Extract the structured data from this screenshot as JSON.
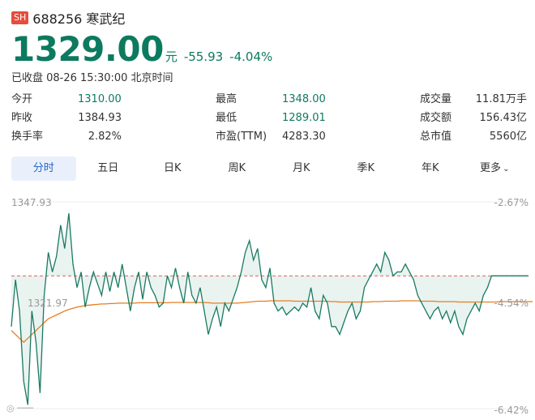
{
  "stock": {
    "market": "SH",
    "code_name": "688256 寒武纪"
  },
  "quote": {
    "price": "1329.00",
    "unit": "元",
    "change": "-55.93",
    "change_pct": "-4.04%"
  },
  "status_text": "已收盘 08-26 15:30:00 北京时间",
  "stats": {
    "open_label": "今开",
    "open": "1310.00",
    "high_label": "最高",
    "high": "1348.00",
    "volume_label": "成交量",
    "volume": "11.81万手",
    "prevclose_label": "昨收",
    "prevclose": "1384.93",
    "low_label": "最低",
    "low": "1289.01",
    "amount_label": "成交额",
    "amount": "156.43亿",
    "turnover_label": "换手率",
    "turnover": "2.82%",
    "pe_label": "市盈(TTM)",
    "pe": "4283.30",
    "mcap_label": "总市值",
    "mcap": "5560亿"
  },
  "tabs": [
    "分时",
    "五日",
    "日K",
    "周K",
    "月K",
    "季K",
    "年K",
    "更多"
  ],
  "chart_data": {
    "type": "line",
    "y_left_ticks": [
      "1347.93",
      "1321.97"
    ],
    "y_right_ticks": [
      "-2.67%",
      "-4.54%",
      "-6.42%"
    ],
    "price_axis": [
      1295.0,
      1347.93
    ],
    "prev_close": 1329.0,
    "series": [
      {
        "values": [
          1316,
          1328,
          1320,
          1302,
          1296,
          1320,
          1312,
          1299,
          1324,
          1335,
          1330,
          1334,
          1342,
          1336,
          1345,
          1332,
          1326,
          1330,
          1321,
          1326,
          1330,
          1327,
          1324,
          1330,
          1325,
          1330,
          1326,
          1332,
          1326,
          1320,
          1326,
          1330,
          1323,
          1330,
          1326,
          1324,
          1321,
          1322,
          1329,
          1326,
          1331,
          1326,
          1322,
          1330,
          1324,
          1322,
          1326,
          1320,
          1314,
          1318,
          1321,
          1316,
          1322,
          1320,
          1323,
          1326,
          1330,
          1335,
          1338,
          1333,
          1336,
          1328,
          1326,
          1331,
          1322,
          1320,
          1321,
          1319,
          1320,
          1321,
          1320,
          1322,
          1321,
          1326,
          1320,
          1318,
          1324,
          1322,
          1316,
          1316,
          1314,
          1317,
          1320,
          1322,
          1318,
          1320,
          1326,
          1328,
          1330,
          1332,
          1330,
          1335,
          1333,
          1329,
          1330,
          1330,
          1332,
          1330,
          1328,
          1324,
          1322,
          1320,
          1318,
          1320,
          1321,
          1318,
          1320,
          1317,
          1320,
          1316,
          1314,
          1318,
          1320,
          1322,
          1320,
          1324,
          1326,
          1329,
          1329,
          1329,
          1329,
          1329,
          1329,
          1329,
          1329,
          1329,
          1329
        ],
        "avg": [
          1315,
          1314,
          1313,
          1312,
          1313,
          1314,
          1315,
          1316,
          1317,
          1318,
          1318.5,
          1319,
          1319.5,
          1320,
          1320.4,
          1320.7,
          1321,
          1321.2,
          1321.4,
          1321.5,
          1321.6,
          1321.7,
          1321.8,
          1321.8,
          1321.9,
          1321.9,
          1322,
          1322,
          1322,
          1322,
          1322,
          1322.1,
          1322.1,
          1322.1,
          1322.1,
          1322.1,
          1322.1,
          1322.1,
          1322.1,
          1322.2,
          1322.2,
          1322.2,
          1322.2,
          1322.2,
          1322.2,
          1322.2,
          1322.2,
          1322.2,
          1322.1,
          1322,
          1322,
          1322,
          1322,
          1322,
          1322,
          1322,
          1322.1,
          1322.2,
          1322.3,
          1322.4,
          1322.5,
          1322.5,
          1322.5,
          1322.6,
          1322.6,
          1322.6,
          1322.6,
          1322.6,
          1322.6,
          1322.5,
          1322.5,
          1322.5,
          1322.5,
          1322.5,
          1322.5,
          1322.5,
          1322.5,
          1322.5,
          1322.4,
          1322.4,
          1322.3,
          1322.3,
          1322.3,
          1322.3,
          1322.3,
          1322.3,
          1322.3,
          1322.3,
          1322.4,
          1322.4,
          1322.4,
          1322.5,
          1322.5,
          1322.5,
          1322.5,
          1322.6,
          1322.6,
          1322.6,
          1322.6,
          1322.6,
          1322.5,
          1322.5,
          1322.5,
          1322.5,
          1322.4,
          1322.4,
          1322.4,
          1322.4,
          1322.4,
          1322.3,
          1322.3,
          1322.3,
          1322.3,
          1322.3,
          1322.3,
          1322.3,
          1322.3,
          1322.3,
          1322.3,
          1322.4,
          1322.4,
          1322.4,
          1322.4,
          1322.4,
          1322.4,
          1322.4,
          1322.4,
          1322.4
        ]
      }
    ],
    "colors": {
      "price": "#1a7a62",
      "avg": "#e67e22",
      "prev_close": "#e35b5b",
      "fill": "#dfeeea"
    }
  }
}
